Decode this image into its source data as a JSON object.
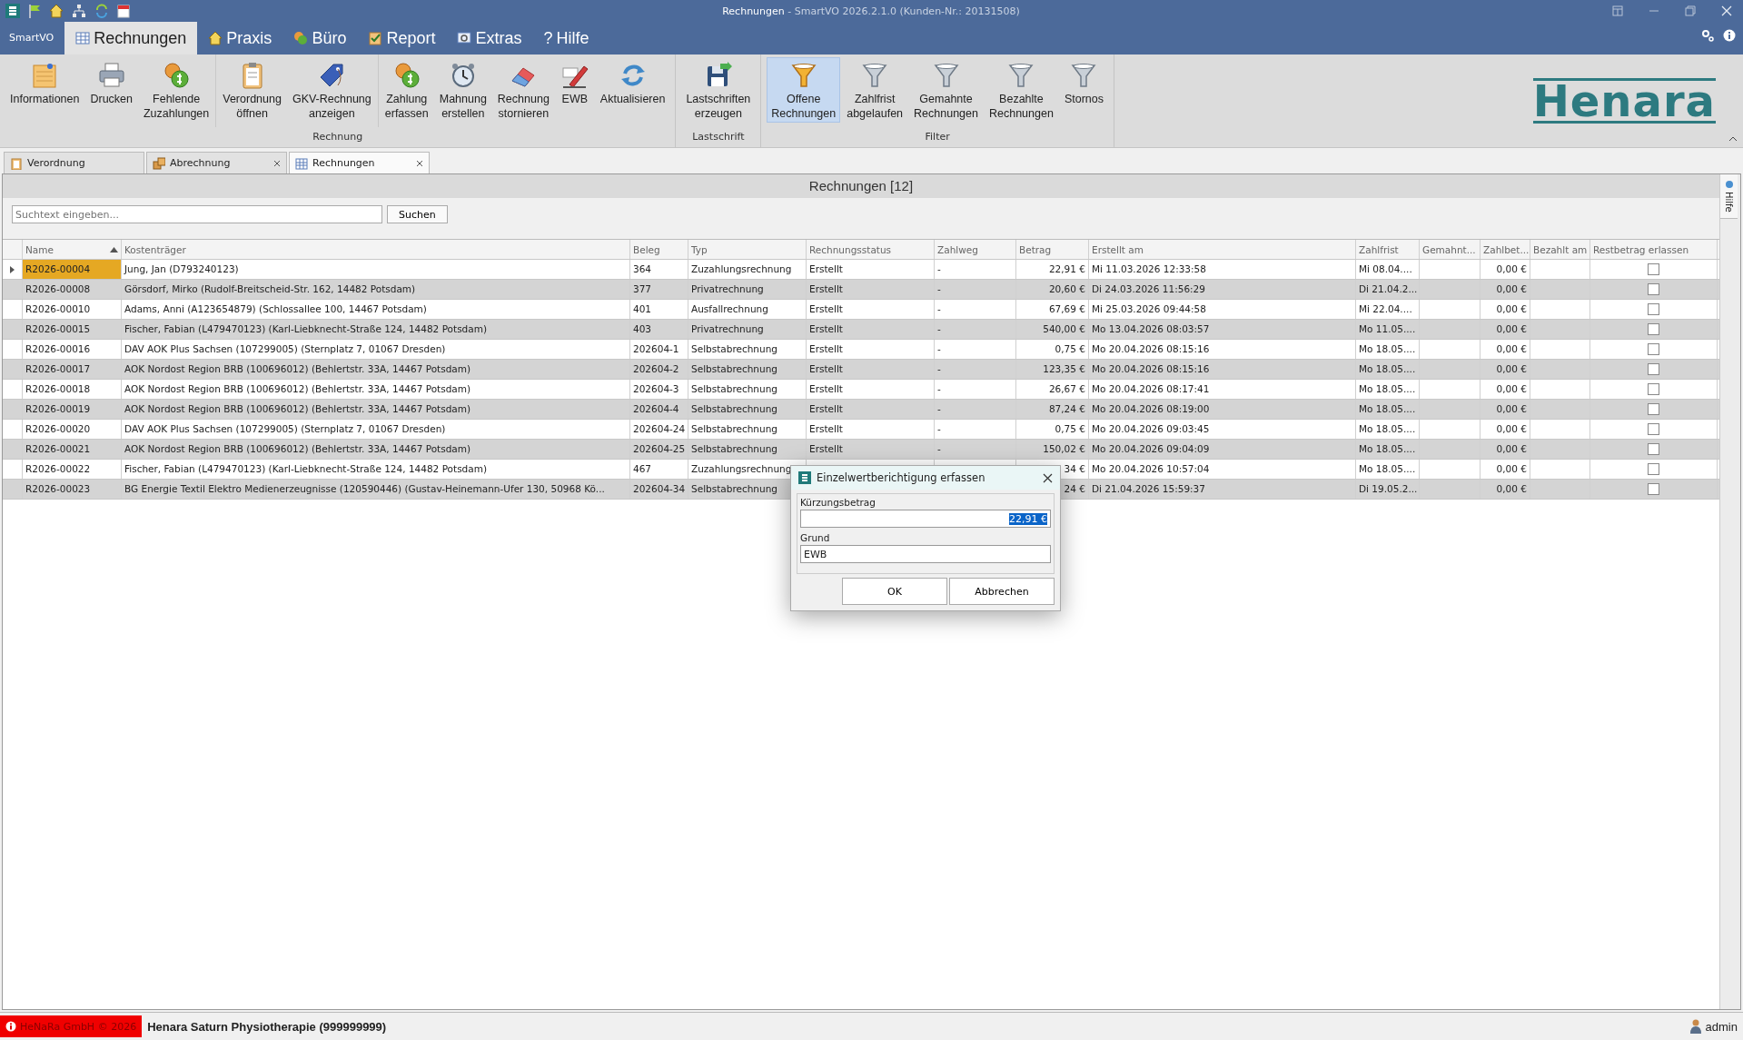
{
  "window": {
    "title_document": "Rechnungen",
    "title_app": "- SmartVO 2026.2.1.0 (Kunden-Nr.: 20131508)"
  },
  "menu": {
    "app_button": "SmartVO",
    "tabs": [
      {
        "label": "Rechnungen",
        "selected": true
      },
      {
        "label": "Praxis",
        "selected": false
      },
      {
        "label": "Büro",
        "selected": false
      },
      {
        "label": "Report",
        "selected": false
      },
      {
        "label": "Extras",
        "selected": false
      },
      {
        "label": "Hilfe",
        "glyph": "?",
        "selected": false
      }
    ]
  },
  "ribbon": {
    "groups": [
      {
        "title": "Rechnung",
        "sections": [
          [
            {
              "label": "Informationen",
              "selected": false
            },
            {
              "label": "Drucken",
              "selected": false
            },
            {
              "label": "Fehlende\nZuzahlungen",
              "selected": false
            }
          ],
          [
            {
              "label": "Verordnung\nöffnen",
              "selected": false
            },
            {
              "label": "GKV-Rechnung\nanzeigen",
              "selected": false
            }
          ],
          [
            {
              "label": "Zahlung\nerfassen",
              "selected": false
            },
            {
              "label": "Mahnung\nerstellen",
              "selected": false
            },
            {
              "label": "Rechnung\nstornieren",
              "selected": false
            },
            {
              "label": "EWB",
              "selected": false
            },
            {
              "label": "Aktualisieren",
              "selected": false
            }
          ]
        ]
      },
      {
        "title": "Lastschrift",
        "sections": [
          [
            {
              "label": "Lastschriften\nerzeugen",
              "selected": false
            }
          ]
        ]
      },
      {
        "title": "Filter",
        "sections": [
          [
            {
              "label": "Offene\nRechnungen",
              "selected": true
            },
            {
              "label": "Zahlfrist\nabgelaufen",
              "selected": false
            },
            {
              "label": "Gemahnte\nRechnungen",
              "selected": false
            },
            {
              "label": "Bezahlte\nRechnungen",
              "selected": false
            },
            {
              "label": "Stornos",
              "selected": false
            }
          ]
        ]
      }
    ],
    "logo": "Henara"
  },
  "doc_tabs": [
    {
      "label": "Verordnung",
      "closable": false,
      "selected": false
    },
    {
      "label": "Abrechnung",
      "closable": true,
      "selected": false
    },
    {
      "label": "Rechnungen",
      "closable": true,
      "selected": true
    }
  ],
  "panel": {
    "title": "Rechnungen [12]",
    "search": {
      "placeholder": "Suchtext eingeben...",
      "button": "Suchen"
    },
    "side_tab": "Hilfe"
  },
  "table": {
    "columns": [
      {
        "kind": "text",
        "label": "Name",
        "sorted": true
      },
      {
        "kind": "text",
        "label": "Kostenträger",
        "sorted": false
      },
      {
        "kind": "text",
        "label": "Beleg",
        "sorted": false
      },
      {
        "kind": "text",
        "label": "Typ",
        "sorted": false
      },
      {
        "kind": "text",
        "label": "Rechnungsstatus",
        "sorted": false
      },
      {
        "kind": "text",
        "label": "Zahlweg",
        "sorted": false
      },
      {
        "kind": "amount",
        "label": "Betrag",
        "sorted": false
      },
      {
        "kind": "text",
        "label": "Erstellt am",
        "sorted": false
      },
      {
        "kind": "text",
        "label": "Zahlfrist",
        "sorted": false
      },
      {
        "kind": "text",
        "label": "Gemahnt...",
        "sorted": false
      },
      {
        "kind": "amount",
        "label": "Zahlbet...",
        "sorted": false
      },
      {
        "kind": "text",
        "label": "Bezahlt am",
        "sorted": false
      },
      {
        "kind": "checkbox",
        "label": "Restbetrag erlassen",
        "sorted": false
      }
    ],
    "rows": [
      {
        "selected": true,
        "restbetrag_erlassen": false,
        "cells": [
          "R2026-00004",
          "Jung, Jan (D793240123)",
          "364",
          "Zuzahlungsrechnung",
          "Erstellt",
          "-",
          "22,91 €",
          "Mi 11.03.2026 12:33:58",
          "Mi 08.04....",
          null,
          "0,00 €",
          null
        ]
      },
      {
        "selected": false,
        "restbetrag_erlassen": false,
        "cells": [
          "R2026-00008",
          "Görsdorf, Mirko (Rudolf-Breitscheid-Str. 162,  14482 Potsdam)",
          "377",
          "Privatrechnung",
          "Erstellt",
          "-",
          "20,60 €",
          "Di 24.03.2026 11:56:29",
          "Di 21.04.2...",
          null,
          "0,00 €",
          null
        ]
      },
      {
        "selected": false,
        "restbetrag_erlassen": false,
        "cells": [
          "R2026-00010",
          "Adams, Anni (A123654879) (Schlossallee 100,  14467 Potsdam)",
          "401",
          "Ausfallrechnung",
          "Erstellt",
          "-",
          "67,69 €",
          "Mi 25.03.2026 09:44:58",
          "Mi 22.04....",
          null,
          "0,00 €",
          null
        ]
      },
      {
        "selected": false,
        "restbetrag_erlassen": false,
        "cells": [
          "R2026-00015",
          "Fischer, Fabian (L479470123) (Karl-Liebknecht-Straße 124,  14482 Potsdam)",
          "403",
          "Privatrechnung",
          "Erstellt",
          "-",
          "540,00 €",
          "Mo 13.04.2026 08:03:57",
          "Mo 11.05....",
          null,
          "0,00 €",
          null
        ]
      },
      {
        "selected": false,
        "restbetrag_erlassen": false,
        "cells": [
          "R2026-00016",
          "DAV AOK Plus Sachsen (107299005) (Sternplatz 7,  01067 Dresden)",
          "202604-1",
          "Selbstabrechnung",
          "Erstellt",
          "-",
          "0,75 €",
          "Mo 20.04.2026 08:15:16",
          "Mo 18.05....",
          null,
          "0,00 €",
          null
        ]
      },
      {
        "selected": false,
        "restbetrag_erlassen": false,
        "cells": [
          "R2026-00017",
          "AOK Nordost Region BRB (100696012) (Behlertstr. 33A,  14467 Potsdam)",
          "202604-2",
          "Selbstabrechnung",
          "Erstellt",
          "-",
          "123,35 €",
          "Mo 20.04.2026 08:15:16",
          "Mo 18.05....",
          null,
          "0,00 €",
          null
        ]
      },
      {
        "selected": false,
        "restbetrag_erlassen": false,
        "cells": [
          "R2026-00018",
          "AOK Nordost Region BRB (100696012) (Behlertstr. 33A,  14467 Potsdam)",
          "202604-3",
          "Selbstabrechnung",
          "Erstellt",
          "-",
          "26,67 €",
          "Mo 20.04.2026 08:17:41",
          "Mo 18.05....",
          null,
          "0,00 €",
          null
        ]
      },
      {
        "selected": false,
        "restbetrag_erlassen": false,
        "cells": [
          "R2026-00019",
          "AOK Nordost Region BRB (100696012) (Behlertstr. 33A,  14467 Potsdam)",
          "202604-4",
          "Selbstabrechnung",
          "Erstellt",
          "-",
          "87,24 €",
          "Mo 20.04.2026 08:19:00",
          "Mo 18.05....",
          null,
          "0,00 €",
          null
        ]
      },
      {
        "selected": false,
        "restbetrag_erlassen": false,
        "cells": [
          "R2026-00020",
          "DAV AOK Plus Sachsen (107299005) (Sternplatz 7,  01067 Dresden)",
          "202604-24",
          "Selbstabrechnung",
          "Erstellt",
          "-",
          "0,75 €",
          "Mo 20.04.2026 09:03:45",
          "Mo 18.05....",
          null,
          "0,00 €",
          null
        ]
      },
      {
        "selected": false,
        "restbetrag_erlassen": false,
        "cells": [
          "R2026-00021",
          "AOK Nordost Region BRB (100696012) (Behlertstr. 33A,  14467 Potsdam)",
          "202604-25",
          "Selbstabrechnung",
          "Erstellt",
          "-",
          "150,02 €",
          "Mo 20.04.2026 09:04:09",
          "Mo 18.05....",
          null,
          "0,00 €",
          null
        ]
      },
      {
        "selected": false,
        "restbetrag_erlassen": false,
        "cells": [
          "R2026-00022",
          "Fischer, Fabian (L479470123) (Karl-Liebknecht-Straße 124,  14482 Potsdam)",
          "467",
          "Zuzahlungsrechnung",
          null,
          null,
          "34 €",
          "Mo 20.04.2026 10:57:04",
          "Mo 18.05....",
          null,
          "0,00 €",
          null
        ]
      },
      {
        "selected": false,
        "restbetrag_erlassen": false,
        "cells": [
          "R2026-00023",
          "BG Energie Textil Elektro Medienerzeugnisse (120590446) (Gustav-Heinemann-Ufer 130,  50968 Kö...",
          "202604-34",
          "Selbstabrechnung",
          null,
          null,
          "24 €",
          "Di 21.04.2026 15:59:37",
          "Di 19.05.2...",
          null,
          "0,00 €",
          null
        ]
      }
    ]
  },
  "dialog": {
    "title": "Einzelwertberichtigung erfassen",
    "fields": [
      {
        "kind": "amount",
        "label": "Kürzungsbetrag",
        "value": "22,91 €",
        "text_selected": true
      },
      {
        "kind": "text",
        "label": "Grund",
        "value": "EWB",
        "text_selected": false
      }
    ],
    "buttons": [
      "OK",
      "Abbrechen"
    ]
  },
  "status_bar": {
    "copyright": "HeNaRa GmbH © 2026",
    "practice": "Henara Saturn Physiotherapie (999999999)",
    "user": "admin"
  }
}
